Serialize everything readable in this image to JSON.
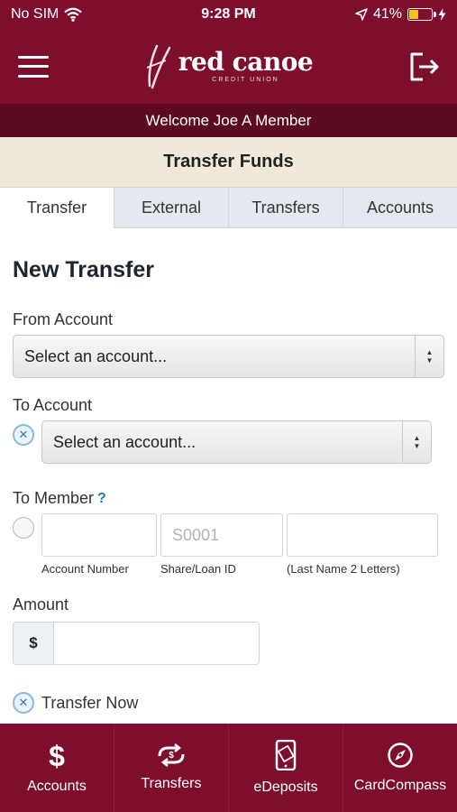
{
  "status_bar": {
    "carrier": "No SIM",
    "time": "9:28 PM",
    "battery": "41%",
    "battery_level": 0.41
  },
  "header": {
    "brand_name": "red canoe",
    "brand_sub": "CREDIT UNION",
    "welcome": "Welcome Joe A Member"
  },
  "page_title": "Transfer Funds",
  "tabs": [
    {
      "label": "Transfer",
      "active": true
    },
    {
      "label": "External",
      "active": false
    },
    {
      "label": "Transfers",
      "active": false
    },
    {
      "label": "Accounts",
      "active": false
    }
  ],
  "form": {
    "heading": "New Transfer",
    "from_label": "From Account",
    "from_value": "Select an account...",
    "to_label": "To Account",
    "to_value": "Select an account...",
    "member_label": "To Member",
    "member_help": "?",
    "account_number_placeholder": "",
    "share_loan_placeholder": "S0001",
    "last_name_placeholder": "",
    "account_number_caption": "Account Number",
    "share_loan_caption": "Share/Loan ID",
    "last_name_caption": "(Last Name  2  Letters)",
    "amount_label": "Amount",
    "currency_symbol": "$",
    "amount_value": "",
    "transfer_now_label": "Transfer Now"
  },
  "bottom_nav": [
    {
      "label": "Accounts",
      "icon": "dollar-icon"
    },
    {
      "label": "Transfers",
      "icon": "transfer-icon"
    },
    {
      "label": "eDeposits",
      "icon": "phone-check-icon"
    },
    {
      "label": "CardCompass",
      "icon": "compass-icon"
    }
  ],
  "colors": {
    "brand": "#7d0f2d",
    "brand_dark": "#5c0a20",
    "title_bg": "#efe9d9",
    "accent": "#2577c4"
  }
}
